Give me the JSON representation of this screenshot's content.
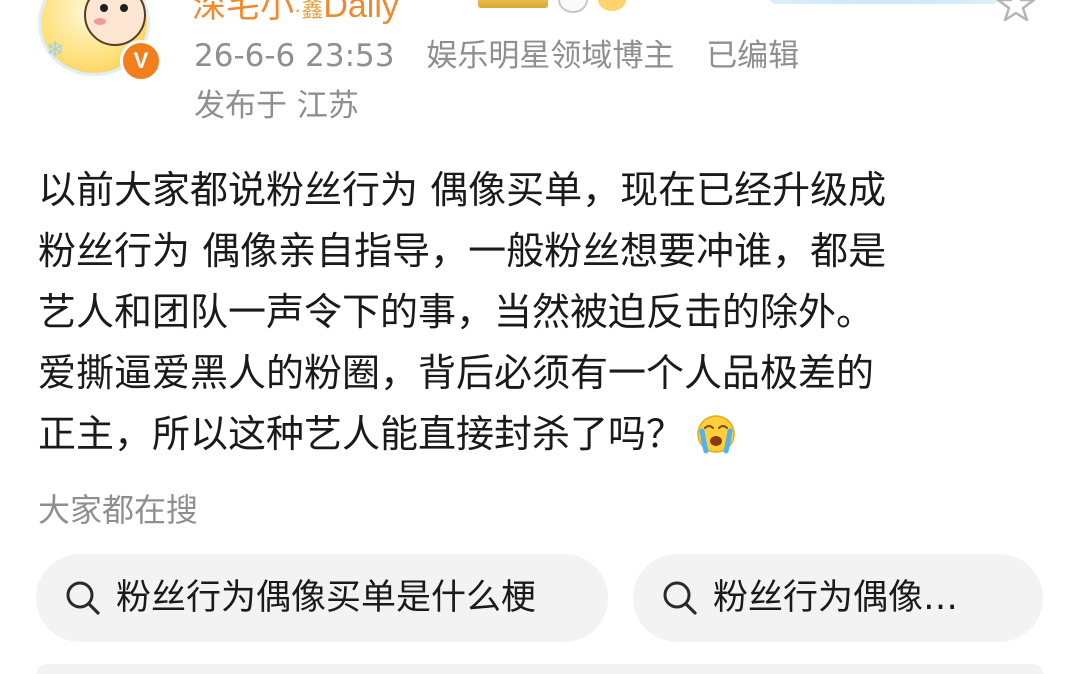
{
  "header": {
    "username": "深宅小",
    "username_suffix": "Daily",
    "username_sep": "·鑫",
    "timestamp": "26-6-6 23:53",
    "role": "娱乐明星领域博主",
    "edited": "已编辑",
    "location": "发布于 江苏",
    "verified_label": "V"
  },
  "post": {
    "lines": [
      "以前大家都说粉丝行为 偶像买单，现在已经升级成",
      "粉丝行为 偶像亲自指导，一般粉丝想要冲谁，都是",
      "艺人和团队一声令下的事，当然被迫反击的除外。",
      "爱撕逼爱黑人的粉圈，背后必须有一个人品极差的",
      "正主，所以这种艺人能直接封杀了吗？"
    ],
    "trailing_emoji": "crying-face-emoji"
  },
  "search": {
    "title": "大家都在搜",
    "chips": [
      "粉丝行为偶像买单是什么梗",
      "粉丝行为偶像…"
    ]
  },
  "colors": {
    "username": "#f08a2e",
    "meta": "#8f8f8f",
    "text": "#1a1a1a",
    "chip_bg": "#f3f3f3",
    "verified": "#f27f1b"
  }
}
